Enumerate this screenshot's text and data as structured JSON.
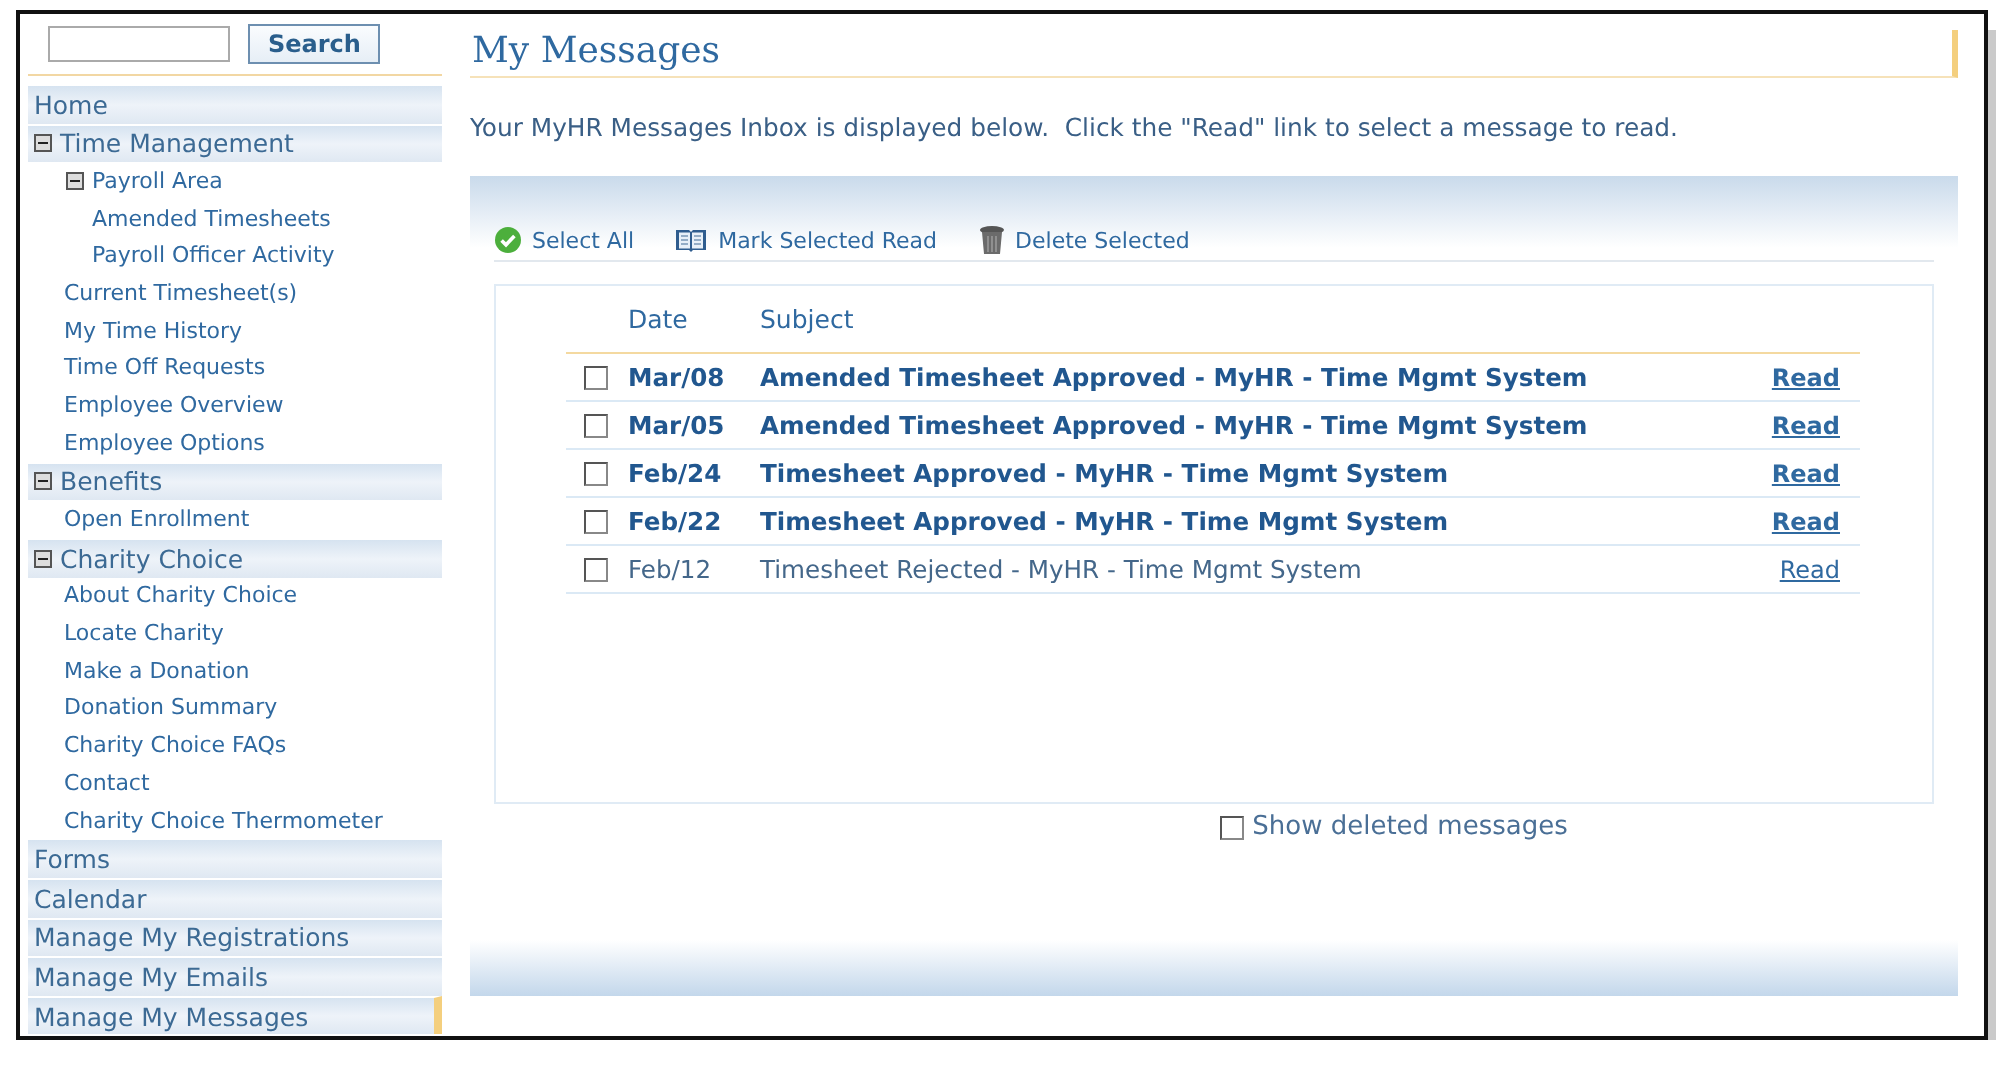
{
  "search": {
    "button": "Search"
  },
  "sidebar": {
    "items": [
      {
        "label": "Home",
        "selected": false
      },
      {
        "label": "Time Management",
        "selected": false,
        "expanded": true,
        "children": [
          {
            "label": "Payroll Area",
            "expanded": true,
            "children": [
              {
                "label": "Amended Timesheets"
              },
              {
                "label": "Payroll Officer Activity"
              }
            ]
          },
          {
            "label": "Current Timesheet(s)"
          },
          {
            "label": "My Time History"
          },
          {
            "label": "Time Off Requests"
          },
          {
            "label": "Employee Overview"
          },
          {
            "label": "Employee Options"
          }
        ]
      },
      {
        "label": "Benefits",
        "selected": false,
        "expanded": true,
        "children": [
          {
            "label": "Open Enrollment"
          }
        ]
      },
      {
        "label": "Charity Choice",
        "selected": false,
        "expanded": true,
        "children": [
          {
            "label": "About Charity Choice"
          },
          {
            "label": "Locate Charity"
          },
          {
            "label": "Make a Donation"
          },
          {
            "label": "Donation Summary"
          },
          {
            "label": "Charity Choice FAQs"
          },
          {
            "label": "Contact"
          },
          {
            "label": "Charity Choice Thermometer"
          }
        ]
      },
      {
        "label": "Forms",
        "selected": false
      },
      {
        "label": "Calendar",
        "selected": false
      },
      {
        "label": "Manage My Registrations",
        "selected": false
      },
      {
        "label": "Manage My Emails",
        "selected": false
      },
      {
        "label": "Manage My Messages",
        "selected": true
      }
    ]
  },
  "page": {
    "title": "My Messages",
    "intro": "Your MyHR Messages Inbox is displayed below.  Click the \"Read\" link to select a message to read."
  },
  "toolbar": [
    {
      "kind": "select",
      "label": "Select All"
    },
    {
      "kind": "mark",
      "label": "Mark Selected Read"
    },
    {
      "kind": "delete",
      "label": "Delete Selected"
    }
  ],
  "table": {
    "columns": [
      "Date",
      "Subject"
    ],
    "rows": [
      {
        "checked": false,
        "unread": true,
        "date": "Mar/08",
        "subject": "Amended Timesheet Approved - MyHR - Time Mgmt System",
        "link": "Read"
      },
      {
        "checked": false,
        "unread": true,
        "date": "Mar/05",
        "subject": "Amended Timesheet Approved - MyHR - Time Mgmt System",
        "link": "Read"
      },
      {
        "checked": false,
        "unread": true,
        "date": "Feb/24",
        "subject": "Timesheet Approved - MyHR - Time Mgmt System",
        "link": "Read"
      },
      {
        "checked": false,
        "unread": true,
        "date": "Feb/22",
        "subject": "Timesheet Approved - MyHR - Time Mgmt System",
        "link": "Read"
      },
      {
        "checked": false,
        "unread": false,
        "date": "Feb/12",
        "subject": "Timesheet Rejected - MyHR - Time Mgmt System",
        "link": "Read"
      }
    ]
  },
  "show_deleted": {
    "label": "Show deleted messages",
    "checked": false
  }
}
